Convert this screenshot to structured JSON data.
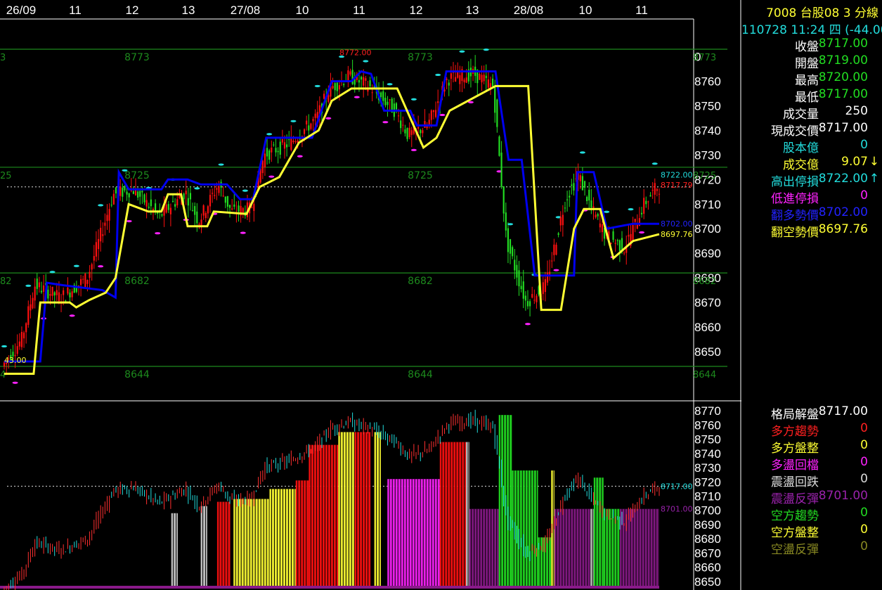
{
  "header": {
    "symbol_line": "7008  台股08 3 分線",
    "datetime_line": "110728 11:24 四",
    "change": "(-44.00)"
  },
  "colors": {
    "bull": "#ff1010",
    "bear": "#22dd22",
    "long_line": "#0000ee",
    "short_line": "#ffff33",
    "cyan": "#22dddd",
    "magenta": "#ff22ff",
    "grid_green": "#1d8a1d"
  },
  "quote_panel": [
    {
      "label": "收盤",
      "value": "8717.00",
      "label_color": "#ffffff",
      "value_color": "#22dd22"
    },
    {
      "label": "開盤",
      "value": "8719.00",
      "label_color": "#ffffff",
      "value_color": "#22dd22"
    },
    {
      "label": "最高",
      "value": "8720.00",
      "label_color": "#ffffff",
      "value_color": "#22dd22"
    },
    {
      "label": "最低",
      "value": "8717.00",
      "label_color": "#ffffff",
      "value_color": "#22dd22"
    },
    {
      "label": "成交量",
      "value": "250",
      "label_color": "#ffffff",
      "value_color": "#ffffff"
    },
    {
      "label": "現成交價",
      "value": "8717.00",
      "label_color": "#ffffff",
      "value_color": "#ffffff"
    },
    {
      "label": "股本億",
      "value": "0",
      "label_color": "#22dddd",
      "value_color": "#22dddd"
    },
    {
      "label": "成交億",
      "value": "9.07",
      "label_color": "#ffff33",
      "value_color": "#ffff33",
      "arrow": "↓"
    },
    {
      "label": "高出停損",
      "value": "8722.00",
      "label_color": "#22dddd",
      "value_color": "#22dddd",
      "arrow": "↑"
    },
    {
      "label": "低進停損",
      "value": "0",
      "label_color": "#ff22ff",
      "value_color": "#ff22ff"
    },
    {
      "label": "翻多勢價",
      "value": "8702.00",
      "label_color": "#2222ff",
      "value_color": "#2222ff"
    },
    {
      "label": "翻空勢價",
      "value": "8697.76",
      "label_color": "#ffff33",
      "value_color": "#ffff33"
    }
  ],
  "pattern_panel": [
    {
      "label": "格局解盤",
      "value": "8717.00",
      "label_color": "#ffffff",
      "value_color": "#ffffff"
    },
    {
      "label": "多方趨勢",
      "value": "0",
      "label_color": "#ff2020",
      "value_color": "#ff2020"
    },
    {
      "label": "多方盤整",
      "value": "0",
      "label_color": "#ffff33",
      "value_color": "#ffff33"
    },
    {
      "label": "多盪回檔",
      "value": "0",
      "label_color": "#ff22ff",
      "value_color": "#ff22ff"
    },
    {
      "label": "震盪回跌",
      "value": "0",
      "label_color": "#dddddd",
      "value_color": "#dddddd"
    },
    {
      "label": "震盪反彈",
      "value": "8701.00",
      "label_color": "#9922aa",
      "value_color": "#9922aa"
    },
    {
      "label": "空方趨勢",
      "value": "0",
      "label_color": "#22dd22",
      "value_color": "#22dd22"
    },
    {
      "label": "空方盤整",
      "value": "0",
      "label_color": "#ffff33",
      "value_color": "#ffff33"
    },
    {
      "label": "空盪反彈",
      "value": "0",
      "label_color": "#888822",
      "value_color": "#888822"
    }
  ],
  "chart_data": [
    {
      "type": "candlestick",
      "x_ticks": [
        "26/09",
        "11",
        "12",
        "13",
        "27/08",
        "10",
        "11",
        "12",
        "13",
        "28/08",
        "10",
        "11"
      ],
      "y_ticks": [
        8650,
        8660,
        8670,
        8680,
        8690,
        8700,
        8710,
        8720,
        8730,
        8740,
        8750,
        8760,
        8770
      ],
      "y_tick_labels": [
        "8650",
        "8660",
        "8670",
        "8680",
        "8690",
        "8700",
        "8710",
        "8720",
        "8730",
        "8740",
        "8750",
        "8760",
        "0"
      ],
      "ylim": [
        8640,
        8773
      ],
      "levels": [
        {
          "value": 8773,
          "label": "8773",
          "edge_labels": [
            "3",
            "8773"
          ]
        },
        {
          "value": 8725,
          "label": "8725",
          "edge_labels": [
            "25",
            "8725"
          ]
        },
        {
          "value": 8682,
          "label": "8682",
          "edge_labels": [
            "82",
            "8682"
          ]
        },
        {
          "value": 8644,
          "label": "8644",
          "edge_labels": [
            "4",
            "8644"
          ]
        }
      ],
      "peak_label": "8772.00",
      "left_label": "43.00",
      "value_labels": [
        {
          "value": 8722.0,
          "text": "8722.00",
          "color": "#22dddd"
        },
        {
          "value": 8717.79,
          "text": "8717.79",
          "color": "#ff2020"
        },
        {
          "value": 8702.0,
          "text": "8702.00",
          "color": "#2222ff"
        },
        {
          "value": 8697.76,
          "text": "8697.76",
          "color": "#ffff33"
        }
      ],
      "current_price": 8717,
      "anchors": [
        [
          0,
          8644
        ],
        [
          0.03,
          8655
        ],
        [
          0.05,
          8677
        ],
        [
          0.09,
          8672
        ],
        [
          0.13,
          8680
        ],
        [
          0.17,
          8714
        ],
        [
          0.2,
          8716
        ],
        [
          0.24,
          8705
        ],
        [
          0.28,
          8715
        ],
        [
          0.3,
          8703
        ],
        [
          0.33,
          8718
        ],
        [
          0.35,
          8707
        ],
        [
          0.38,
          8708
        ],
        [
          0.4,
          8730
        ],
        [
          0.44,
          8735
        ],
        [
          0.48,
          8745
        ],
        [
          0.5,
          8757
        ],
        [
          0.53,
          8762
        ],
        [
          0.56,
          8758
        ],
        [
          0.6,
          8748
        ],
        [
          0.62,
          8738
        ],
        [
          0.65,
          8742
        ],
        [
          0.68,
          8761
        ],
        [
          0.72,
          8763
        ],
        [
          0.75,
          8758
        ],
        [
          0.77,
          8695
        ],
        [
          0.8,
          8670
        ],
        [
          0.83,
          8677
        ],
        [
          0.86,
          8712
        ],
        [
          0.88,
          8722
        ],
        [
          0.9,
          8708
        ],
        [
          0.92,
          8698
        ],
        [
          0.95,
          8692
        ],
        [
          0.98,
          8710
        ],
        [
          1,
          8717
        ]
      ],
      "long_line": [
        [
          0,
          8646
        ],
        [
          0.055,
          8646
        ],
        [
          0.065,
          8678
        ],
        [
          0.09,
          8677
        ],
        [
          0.15,
          8675
        ],
        [
          0.17,
          8672
        ],
        [
          0.175,
          8723
        ],
        [
          0.19,
          8716
        ],
        [
          0.24,
          8716
        ],
        [
          0.25,
          8720
        ],
        [
          0.28,
          8720
        ],
        [
          0.3,
          8718
        ],
        [
          0.34,
          8718
        ],
        [
          0.36,
          8712
        ],
        [
          0.38,
          8712
        ],
        [
          0.4,
          8737
        ],
        [
          0.47,
          8737
        ],
        [
          0.5,
          8760
        ],
        [
          0.53,
          8760
        ],
        [
          0.545,
          8764
        ],
        [
          0.56,
          8763
        ],
        [
          0.58,
          8748
        ],
        [
          0.62,
          8748
        ],
        [
          0.63,
          8742
        ],
        [
          0.66,
          8742
        ],
        [
          0.675,
          8764
        ],
        [
          0.75,
          8764
        ],
        [
          0.77,
          8728
        ],
        [
          0.79,
          8728
        ],
        [
          0.81,
          8681
        ],
        [
          0.87,
          8681
        ],
        [
          0.875,
          8723
        ],
        [
          0.9,
          8723
        ],
        [
          0.92,
          8700
        ],
        [
          0.96,
          8702
        ],
        [
          1,
          8702
        ]
      ],
      "short_line": [
        [
          0,
          8641
        ],
        [
          0.045,
          8641
        ],
        [
          0.055,
          8670
        ],
        [
          0.1,
          8670
        ],
        [
          0.11,
          8668
        ],
        [
          0.13,
          8671
        ],
        [
          0.155,
          8674
        ],
        [
          0.17,
          8680
        ],
        [
          0.19,
          8710
        ],
        [
          0.22,
          8707
        ],
        [
          0.24,
          8707
        ],
        [
          0.25,
          8714
        ],
        [
          0.27,
          8714
        ],
        [
          0.28,
          8701
        ],
        [
          0.31,
          8701
        ],
        [
          0.32,
          8707
        ],
        [
          0.37,
          8706
        ],
        [
          0.39,
          8717
        ],
        [
          0.42,
          8721
        ],
        [
          0.45,
          8735
        ],
        [
          0.48,
          8740
        ],
        [
          0.5,
          8752
        ],
        [
          0.53,
          8757
        ],
        [
          0.6,
          8757
        ],
        [
          0.62,
          8745
        ],
        [
          0.64,
          8733
        ],
        [
          0.66,
          8737
        ],
        [
          0.68,
          8748
        ],
        [
          0.75,
          8758
        ],
        [
          0.8,
          8758
        ],
        [
          0.82,
          8667
        ],
        [
          0.85,
          8667
        ],
        [
          0.87,
          8700
        ],
        [
          0.885,
          8708
        ],
        [
          0.91,
          8708
        ],
        [
          0.93,
          8688
        ],
        [
          0.96,
          8695
        ],
        [
          1,
          8697.76
        ]
      ],
      "pattern_blocks": [
        {
          "from": 0.255,
          "to": 0.265,
          "top": 8698,
          "color": "#cccccc"
        },
        {
          "from": 0.3,
          "to": 0.31,
          "top": 8703,
          "color": "#cccccc"
        },
        {
          "from": 0.325,
          "to": 0.345,
          "top": 8706,
          "color": "#ff1010"
        },
        {
          "from": 0.35,
          "to": 0.405,
          "top": 8708,
          "color": "#ffff33"
        },
        {
          "from": 0.405,
          "to": 0.445,
          "top": 8715,
          "color": "#ffff33"
        },
        {
          "from": 0.445,
          "to": 0.465,
          "top": 8721,
          "color": "#ff1010"
        },
        {
          "from": 0.465,
          "to": 0.51,
          "top": 8746,
          "color": "#ff1010"
        },
        {
          "from": 0.51,
          "to": 0.535,
          "top": 8755,
          "color": "#ffff33"
        },
        {
          "from": 0.535,
          "to": 0.56,
          "top": 8755,
          "color": "#ff1010"
        },
        {
          "from": 0.565,
          "to": 0.575,
          "top": 8755,
          "color": "#ffff33"
        },
        {
          "from": 0.585,
          "to": 0.665,
          "top": 8722,
          "color": "#ff22ff"
        },
        {
          "from": 0.665,
          "to": 0.705,
          "top": 8748,
          "color": "#ff1010"
        },
        {
          "from": 0.705,
          "to": 0.71,
          "top": 8748,
          "color": "#cccccc"
        },
        {
          "from": 0.71,
          "to": 0.755,
          "top": 8701,
          "color": "#8a1a8a"
        },
        {
          "from": 0.755,
          "to": 0.775,
          "top": 8767,
          "color": "#22dd22"
        },
        {
          "from": 0.775,
          "to": 0.815,
          "top": 8728,
          "color": "#22dd22"
        },
        {
          "from": 0.815,
          "to": 0.835,
          "top": 8681,
          "color": "#22dd22"
        },
        {
          "from": 0.835,
          "to": 0.84,
          "top": 8728,
          "color": "#ffff33"
        },
        {
          "from": 0.84,
          "to": 0.895,
          "top": 8701,
          "color": "#8a1a8a"
        },
        {
          "from": 0.895,
          "to": 0.9,
          "top": 8701,
          "color": "#cccccc"
        },
        {
          "from": 0.9,
          "to": 0.915,
          "top": 8723,
          "color": "#22dd22"
        },
        {
          "from": 0.915,
          "to": 0.94,
          "top": 8701,
          "color": "#22dd22"
        },
        {
          "from": 0.94,
          "to": 1.0,
          "top": 8701,
          "color": "#8a1a8a"
        }
      ]
    },
    {
      "type": "bar",
      "y_ticks": [
        8650,
        8660,
        8670,
        8680,
        8690,
        8700,
        8710,
        8720,
        8730,
        8740,
        8750,
        8760,
        8770
      ],
      "ylim": [
        8646,
        8773
      ],
      "value_labels": [
        {
          "value": 8717.0,
          "text": "8717.00",
          "color": "#22dddd"
        },
        {
          "value": 8701.0,
          "text": "8701.00",
          "color": "#9922aa"
        }
      ]
    }
  ]
}
